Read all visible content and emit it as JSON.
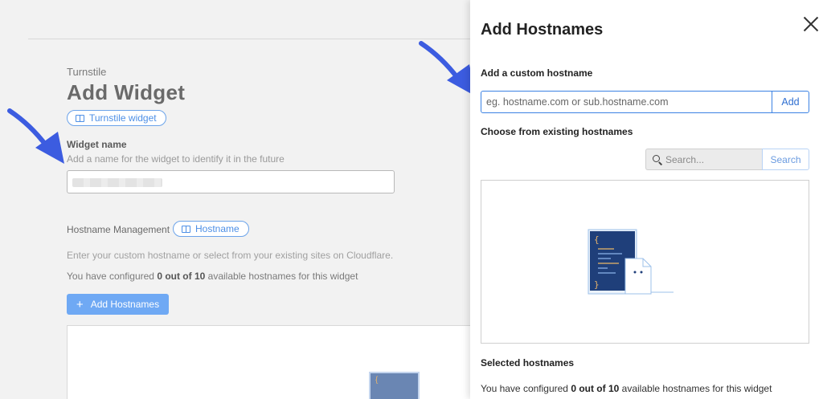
{
  "page": {
    "eyebrow": "Turnstile",
    "title": "Add Widget",
    "turnstile_pill": "Turnstile widget",
    "widget_name_label": "Widget name",
    "widget_name_help": "Add a name for the widget to identify it in the future",
    "hostname_mgmt_label": "Hostname Management",
    "hostname_pill": "Hostname",
    "hostname_help": "Enter your custom hostname or select from your existing sites on Cloudflare.",
    "count_prefix": "You have configured ",
    "count_value": "0 out of 10",
    "count_suffix": " available hostnames for this widget",
    "add_hostnames_button": "Add Hostnames",
    "add_icon": "+"
  },
  "drawer": {
    "title": "Add Hostnames",
    "custom_label": "Add a custom hostname",
    "custom_placeholder": "eg. hostname.com or sub.hostname.com",
    "add_button": "Add",
    "existing_label": "Choose from existing hostnames",
    "search_placeholder": "Search...",
    "search_button": "Search",
    "selected_label": "Selected hostnames",
    "count_prefix": "You have configured ",
    "count_value": "0 out of 10",
    "count_suffix": " available hostnames for this widget"
  },
  "colors": {
    "accent": "#3b82e3",
    "arrow": "#3c5ce0",
    "primary_button": "#6fa9f4"
  },
  "icons": [
    "book-icon",
    "plus-icon",
    "close-icon",
    "search-icon",
    "empty-document-illustration",
    "arrow-pointer"
  ]
}
